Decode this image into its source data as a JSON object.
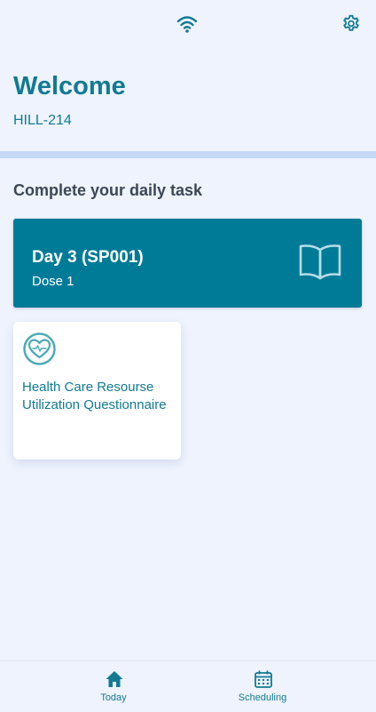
{
  "header": {
    "title": "Welcome",
    "subject_id": "HILL-214",
    "status_icon": "wifi-icon",
    "settings_icon": "gear-icon"
  },
  "main": {
    "section_heading": "Complete your daily task",
    "day_card": {
      "title": "Day 3 (SP001)",
      "subtitle": "Dose 1",
      "icon": "book-icon"
    },
    "tasks": [
      {
        "label": "Health Care Resourse Utilization Questionnaire",
        "icon": "heart-pulse-icon"
      }
    ]
  },
  "bottom_nav": {
    "items": [
      {
        "label": "Today",
        "icon": "home-icon"
      },
      {
        "label": "Scheduling",
        "icon": "calendar-icon"
      }
    ]
  },
  "colors": {
    "background": "#eef3fd",
    "accent": "#127a93",
    "card_primary": "#007b97",
    "divider": "#c6d8f7",
    "heading": "#3d4657"
  }
}
